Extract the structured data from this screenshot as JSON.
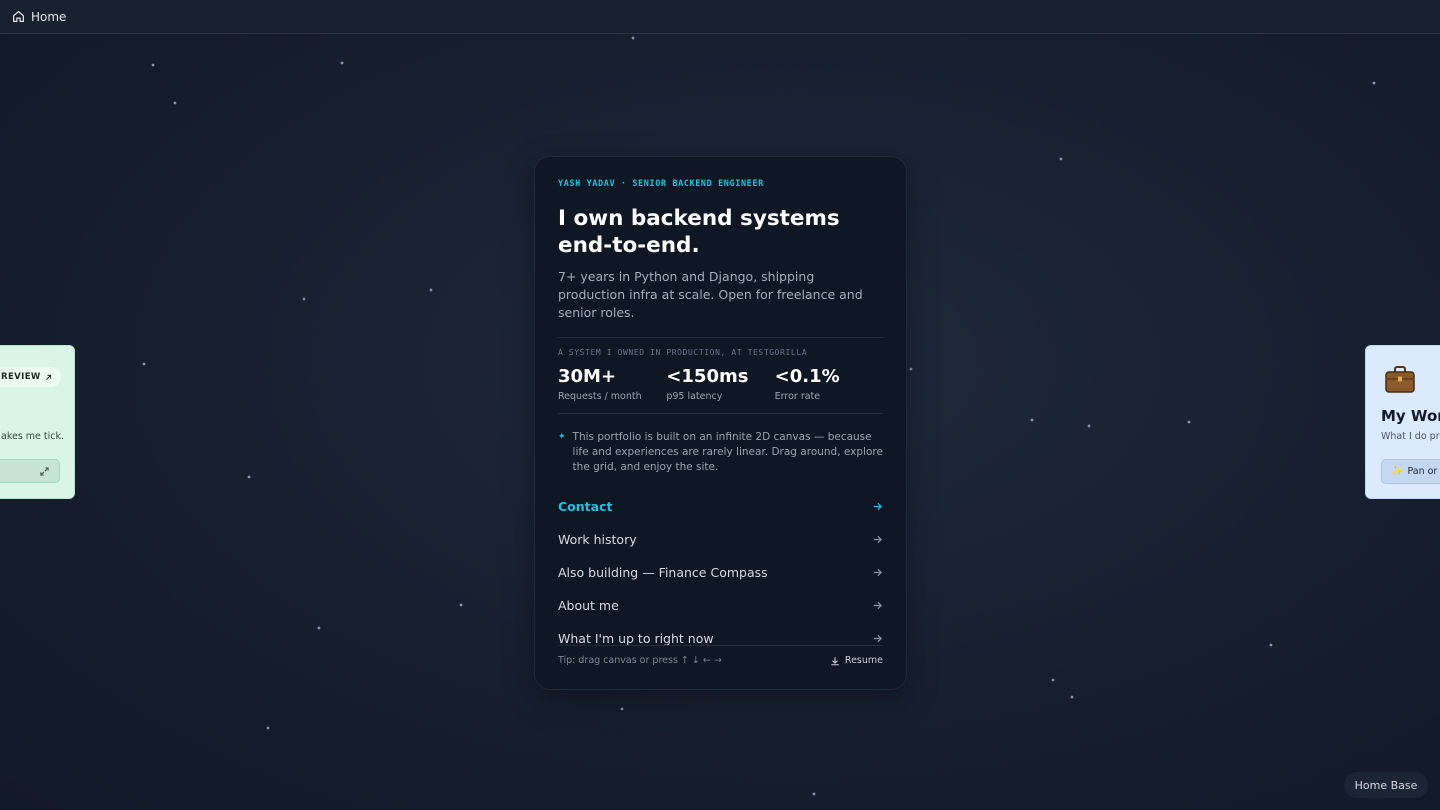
{
  "topbar": {
    "home_label": "Home"
  },
  "card": {
    "eyebrow": "YASH YADAV · SENIOR BACKEND ENGINEER",
    "headline_line1": "I own backend systems",
    "headline_line2": "end-to-end.",
    "subtitle": "7+ years in Python and Django, shipping production infra at scale. Open for freelance and senior roles.",
    "system_label": "A SYSTEM I OWNED IN PRODUCTION, AT TESTGORILLA",
    "stats": [
      {
        "value": "30M+",
        "label": "Requests / month"
      },
      {
        "value": "<150ms",
        "label": "p95 latency"
      },
      {
        "value": "<0.1%",
        "label": "Error rate"
      }
    ],
    "note": "This portfolio is built on an infinite 2D canvas — because life and experiences are rarely linear. Drag around, explore the grid, and enjoy the site.",
    "menu": [
      {
        "label": "Contact"
      },
      {
        "label": "Work history"
      },
      {
        "label": "Also building — Finance Compass"
      },
      {
        "label": "About me"
      },
      {
        "label": "What I'm up to right now"
      }
    ],
    "tip": "Tip: drag canvas or press ↑ ↓ ← →",
    "resume_label": "Resume"
  },
  "left_card": {
    "pill_label": "REVIEW",
    "tick_text": "akes me tick."
  },
  "right_card": {
    "title": "My Wor",
    "subtitle": "What I do pr",
    "button_label": "Pan or d"
  },
  "home_base_label": "Home Base",
  "colors": {
    "accent": "#22c3dd",
    "card_bg": "#0f1624",
    "left_card_bg": "#d8f5e6",
    "right_card_bg": "#dbeafe"
  }
}
